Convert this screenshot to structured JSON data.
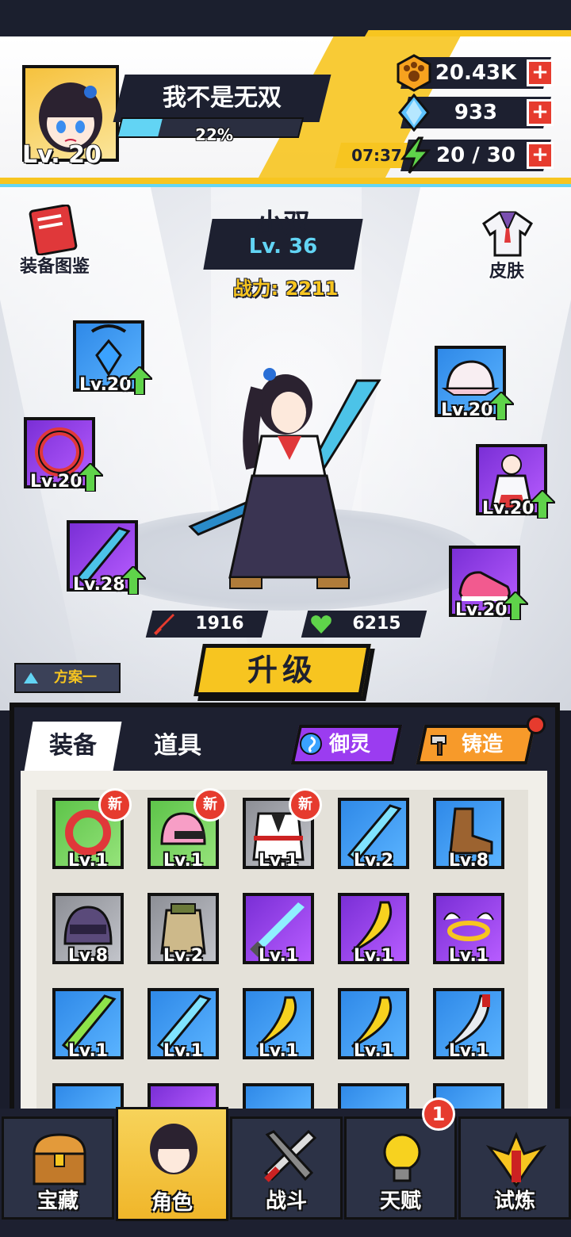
{
  "player": {
    "name": "我不是无双",
    "level": "Lv. 20",
    "exp_percent": "22%",
    "exp_fraction": 0.22
  },
  "resources": {
    "gold": "20.43K",
    "gems": "933",
    "energy": "20 / 30",
    "energy_timer": "07:37",
    "plus": "+"
  },
  "character": {
    "name": "小双",
    "level": "Lv. 36",
    "power": "战力: 2211",
    "attack": "1916",
    "health": "6215"
  },
  "side_buttons": {
    "handbook": "装备图鉴",
    "skin": "皮肤"
  },
  "equipped_slots": [
    {
      "level": "Lv.20",
      "icon": "pendant-icon"
    },
    {
      "level": "Lv.20",
      "icon": "ring-icon"
    },
    {
      "level": "Lv.28",
      "icon": "blade-icon"
    },
    {
      "level": "Lv.20",
      "icon": "cap-icon"
    },
    {
      "level": "Lv.20",
      "icon": "costume-icon"
    },
    {
      "level": "Lv.20",
      "icon": "sneaker-icon"
    }
  ],
  "actions": {
    "upgrade": "升级",
    "plan": "方案一",
    "spirit": "御灵",
    "forge": "铸造"
  },
  "tabs": {
    "equipment": "装备",
    "items": "道具"
  },
  "inventory": [
    {
      "level": "Lv.1",
      "new": "新",
      "rarity": "green",
      "icon": "ring-icon"
    },
    {
      "level": "Lv.1",
      "new": "新",
      "rarity": "green",
      "icon": "helmet-icon"
    },
    {
      "level": "Lv.1",
      "new": "新",
      "rarity": "gray",
      "icon": "robe-icon"
    },
    {
      "level": "Lv.2",
      "new": "",
      "rarity": "blue",
      "icon": "blade-icon"
    },
    {
      "level": "Lv.8",
      "new": "",
      "rarity": "blue",
      "icon": "boot-icon"
    },
    {
      "level": "Lv.8",
      "new": "",
      "rarity": "gray",
      "icon": "combat-helmet-icon"
    },
    {
      "level": "Lv.2",
      "new": "",
      "rarity": "gray",
      "icon": "coat-icon"
    },
    {
      "level": "Lv.1",
      "new": "",
      "rarity": "purple",
      "icon": "lightsaber-icon"
    },
    {
      "level": "Lv.1",
      "new": "",
      "rarity": "purple",
      "icon": "banana-icon"
    },
    {
      "level": "Lv.1",
      "new": "",
      "rarity": "purple",
      "icon": "halo-icon"
    },
    {
      "level": "Lv.1",
      "new": "",
      "rarity": "blue",
      "icon": "green-blade-icon"
    },
    {
      "level": "Lv.1",
      "new": "",
      "rarity": "blue",
      "icon": "blade-icon"
    },
    {
      "level": "Lv.1",
      "new": "",
      "rarity": "blue",
      "icon": "banana-icon"
    },
    {
      "level": "Lv.1",
      "new": "",
      "rarity": "blue",
      "icon": "banana-icon"
    },
    {
      "level": "Lv.1",
      "new": "",
      "rarity": "blue",
      "icon": "machete-icon"
    }
  ],
  "nav": {
    "treasure": "宝藏",
    "role": "角色",
    "battle": "战斗",
    "talent": "天赋",
    "trial": "试炼",
    "talent_badge": "1"
  },
  "colors": {
    "accent_yellow": "#f7c520",
    "dark_navy": "#1d2030",
    "cyan": "#62d4f4",
    "red": "#e63b2e"
  }
}
